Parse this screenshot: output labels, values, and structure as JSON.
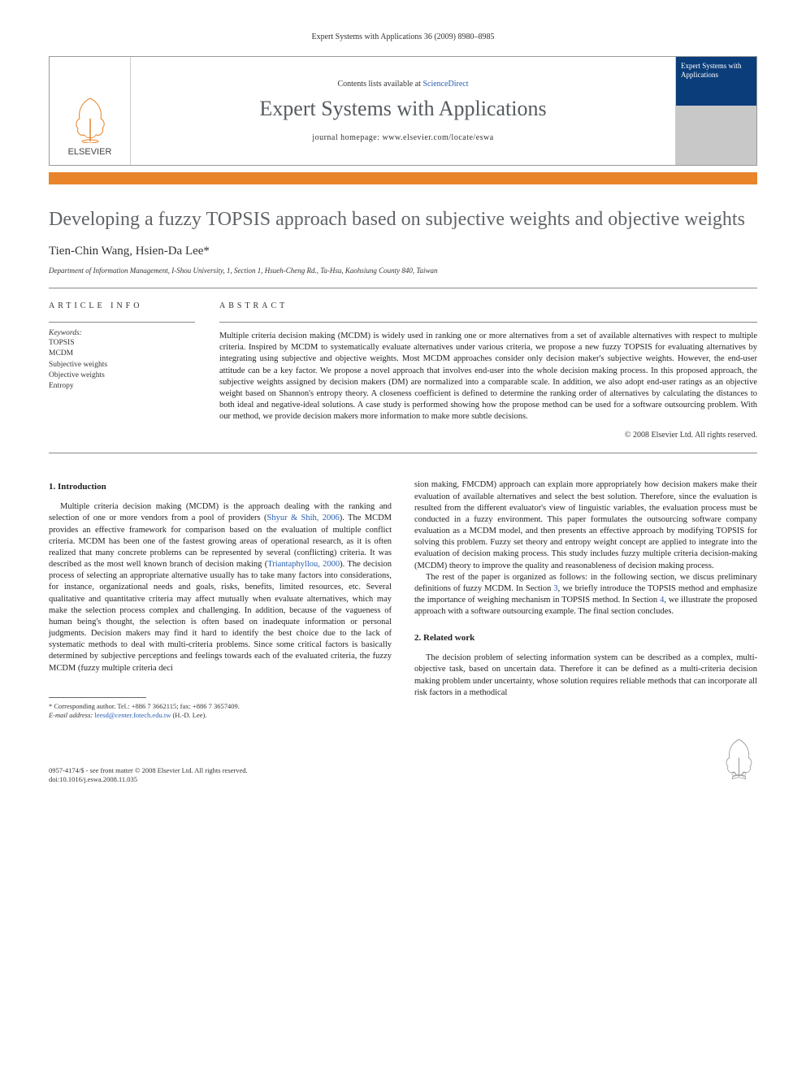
{
  "header_bar": "Expert Systems with Applications 36 (2009) 8980–8985",
  "banner": {
    "publisher": "ELSEVIER",
    "contents_prefix": "Contents lists available at ",
    "contents_link": "ScienceDirect",
    "journal_name": "Expert Systems with Applications",
    "homepage_label": "journal homepage: www.elsevier.com/locate/eswa",
    "cover_text": "Expert Systems with Applications"
  },
  "article": {
    "title": "Developing a fuzzy TOPSIS approach based on subjective weights and objective weights",
    "authors": "Tien-Chin Wang, Hsien-Da Lee*",
    "affiliation": "Department of Information Management, I-Shou University, 1, Section 1, Hsueh-Cheng Rd., Ta-Hsu, Kaohsiung County 840, Taiwan"
  },
  "info": {
    "heading": "ARTICLE INFO",
    "keywords_label": "Keywords:",
    "keywords": [
      "TOPSIS",
      "MCDM",
      "Subjective weights",
      "Objective weights",
      "Entropy"
    ]
  },
  "abstract": {
    "heading": "ABSTRACT",
    "text": "Multiple criteria decision making (MCDM) is widely used in ranking one or more alternatives from a set of available alternatives with respect to multiple criteria. Inspired by MCDM to systematically evaluate alternatives under various criteria, we propose a new fuzzy TOPSIS for evaluating alternatives by integrating using subjective and objective weights. Most MCDM approaches consider only decision maker's subjective weights. However, the end-user attitude can be a key factor. We propose a novel approach that involves end-user into the whole decision making process. In this proposed approach, the subjective weights assigned by decision makers (DM) are normalized into a comparable scale. In addition, we also adopt end-user ratings as an objective weight based on Shannon's entropy theory. A closeness coefficient is defined to determine the ranking order of alternatives by calculating the distances to both ideal and negative-ideal solutions. A case study is performed showing how the propose method can be used for a software outsourcing problem. With our method, we provide decision makers more information to make more subtle decisions.",
    "copyright": "© 2008 Elsevier Ltd. All rights reserved."
  },
  "sections": {
    "s1_heading": "1. Introduction",
    "s1_p1a": "Multiple criteria decision making (MCDM) is the approach dealing with the ranking and selection of one or more vendors from a pool of providers (",
    "s1_ref1": "Shyur & Shih, 2006",
    "s1_p1b": "). The MCDM provides an effective framework for comparison based on the evaluation of multiple conflict criteria. MCDM has been one of the fastest growing areas of operational research, as it is often realized that many concrete problems can be represented by several (conflicting) criteria. It was described as the most well known branch of decision making (",
    "s1_ref2": "Triantaphyllou, 2000",
    "s1_p1c": "). The decision process of selecting an appropriate alternative usually has to take many factors into considerations, for instance, organizational needs and goals, risks, benefits, limited resources, etc. Several qualitative and quantitative criteria may affect mutually when evaluate alternatives, which may make the selection process complex and challenging. In addition, because of the vagueness of human being's thought, the selection is often based on inadequate information or personal judgments. Decision makers may find it hard to identify the best choice due to the lack of systematic methods to deal with multi-criteria problems. Since some critical factors is basically determined by subjective perceptions and feelings towards each of the evaluated criteria, the fuzzy MCDM (fuzzy multiple criteria deci",
    "s1_p1d": "sion making, FMCDM) approach can explain more appropriately how decision makers make their evaluation of available alternatives and select the best solution. Therefore, since the evaluation is resulted from the different evaluator's view of linguistic variables, the evaluation process must be conducted in a fuzzy environment. This paper formulates the outsourcing software company evaluation as a MCDM model, and then presents an effective approach by modifying TOPSIS for solving this problem. Fuzzy set theory and entropy weight concept are applied to integrate into the evaluation of decision making process. This study includes fuzzy multiple criteria decision-making (MCDM) theory to improve the quality and reasonableness of decision making process.",
    "s1_p2a": "The rest of the paper is organized as follows: in the following section, we discus preliminary definitions of fuzzy MCDM. In Section ",
    "s1_sec3": "3",
    "s1_p2b": ", we briefly introduce the TOPSIS method and emphasize the importance of weighing mechanism in TOPSIS method. In Section ",
    "s1_sec4": "4",
    "s1_p2c": ", we illustrate the proposed approach with a software outsourcing example. The final section concludes.",
    "s2_heading": "2. Related work",
    "s2_p1": "The decision problem of selecting information system can be described as a complex, multi-objective task, based on uncertain data. Therefore it can be defined as a multi-criteria decision making problem under uncertainty, whose solution requires reliable methods that can incorporate all risk factors in a methodical"
  },
  "footnote": {
    "corresponding": "* Corresponding author. Tel.: +886 7 3662115; fax: +886 7 3657409.",
    "email_label": "E-mail address: ",
    "email": "leesd@center.fotech.edu.tw",
    "email_suffix": " (H.-D. Lee)."
  },
  "footer": {
    "issn_line": "0957-4174/$ - see front matter © 2008 Elsevier Ltd. All rights reserved.",
    "doi_line": "doi:10.1016/j.eswa.2008.11.035"
  }
}
